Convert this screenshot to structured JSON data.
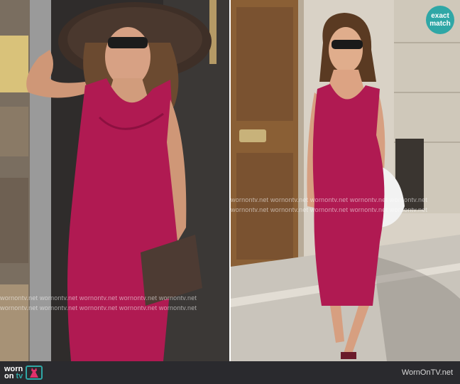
{
  "badge": {
    "line1": "exact",
    "line2": "match"
  },
  "watermark": {
    "left_row1": "wornontv.net  wornontv.net  wornontv.net  wornontv.net  wornontv.net",
    "left_row2": "wornontv.net  wornontv.net  wornontv.net  wornontv.net  wornontv.net",
    "right_row1": "wornontv.net  wornontv.net  wornontv.net  wornontv.net  wornontv.net",
    "right_row2": "wornontv.net  wornontv.net  wornontv.net  wornontv.net  wornontv.net"
  },
  "footer": {
    "logo_worn": "worn",
    "logo_on": "on",
    "logo_tv": "tv",
    "site": "WornOnTV.net"
  },
  "colors": {
    "dress": "#b01a52",
    "accent": "#2fa7a6",
    "footer_bg": "#2a2a2e"
  }
}
